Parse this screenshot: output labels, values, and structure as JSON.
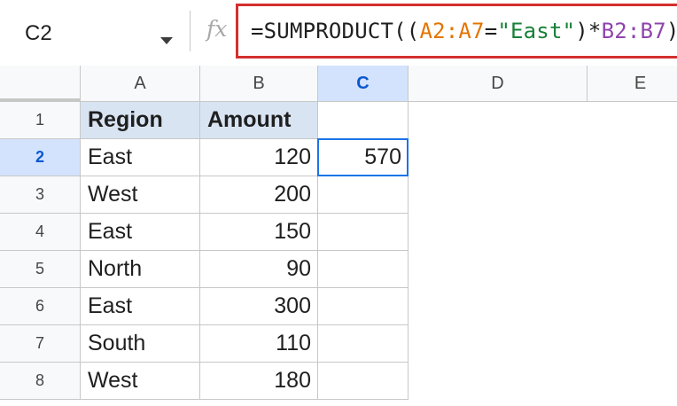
{
  "name_box": {
    "value": "C2"
  },
  "formula_bar": {
    "fx_label": "fx",
    "parts": [
      {
        "text": "=SUMPRODUCT((",
        "kind": "plain"
      },
      {
        "text": "A2:A7",
        "kind": "range1"
      },
      {
        "text": "=",
        "kind": "plain"
      },
      {
        "text": "\"East\"",
        "kind": "string"
      },
      {
        "text": ")*",
        "kind": "plain"
      },
      {
        "text": "B2:B7",
        "kind": "range2"
      },
      {
        "text": ")",
        "kind": "plain"
      }
    ],
    "highlight_color": "#d32f2f"
  },
  "columns": [
    "A",
    "B",
    "C",
    "D",
    "E"
  ],
  "active_column": "C",
  "active_row": 2,
  "rows": [
    {
      "n": "1",
      "A": "Region",
      "B": "Amount",
      "C": ""
    },
    {
      "n": "2",
      "A": "East",
      "B": "120",
      "C": "570"
    },
    {
      "n": "3",
      "A": "West",
      "B": "200",
      "C": ""
    },
    {
      "n": "4",
      "A": "East",
      "B": "150",
      "C": ""
    },
    {
      "n": "5",
      "A": "North",
      "B": "90",
      "C": ""
    },
    {
      "n": "6",
      "A": "East",
      "B": "300",
      "C": ""
    },
    {
      "n": "7",
      "A": "South",
      "B": "110",
      "C": ""
    },
    {
      "n": "8",
      "A": "West",
      "B": "180",
      "C": ""
    }
  ],
  "colors": {
    "header_fill": "#d9e4f3",
    "selection": "#1a73e8",
    "active_header": "#d3e3fd"
  }
}
